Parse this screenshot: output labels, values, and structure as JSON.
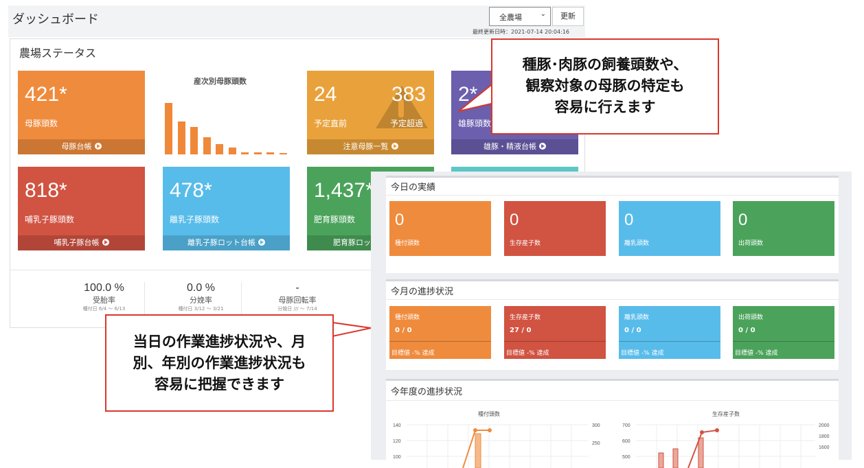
{
  "header": {
    "title": "ダッシュボード",
    "farm_select": "全農場",
    "refresh_label": "更新",
    "last_updated": "最終更新日時：2021-07-14 20:04:16"
  },
  "status": {
    "title": "農場ステータス",
    "sow": {
      "value": "421*",
      "label": "母豚頭数",
      "link": "母豚台帳"
    },
    "parity_chart": {
      "title": "産次別母豚頭数",
      "values": [
        72,
        46,
        38,
        24,
        14,
        10,
        3,
        3,
        3,
        1
      ]
    },
    "due": {
      "value_left": "24",
      "label_left": "予定直前",
      "value_right": "383",
      "label_right": "予定超過",
      "link": "注意母豚一覧"
    },
    "boar": {
      "value": "2*",
      "label": "雄豚頭数",
      "link": "雄豚・精液台帳"
    },
    "suckling": {
      "value": "818*",
      "label": "哺乳子豚頭数",
      "link": "哺乳子豚台帳"
    },
    "weaned": {
      "value": "478*",
      "label": "離乳子豚頭数",
      "link": "離乳子豚ロット台帳"
    },
    "fattening": {
      "value": "1,437*",
      "label": "肥育豚頭数",
      "link": "肥育豚ロッ"
    },
    "stats": [
      {
        "value": "100.0 %",
        "label": "受胎率",
        "sub": "種付日 6/4 ～ 6/13"
      },
      {
        "value": "0.0 %",
        "label": "分娩率",
        "sub": "種付日 3/12 ～ 3/21"
      },
      {
        "value": "-",
        "label": "母豚回転率",
        "sub": "分娩日 /// ～ 7/14"
      }
    ]
  },
  "today": {
    "title": "今日の実績",
    "tiles": [
      {
        "value": "0",
        "label": "種付頭数",
        "color": "#ef8b3d"
      },
      {
        "value": "0",
        "label": "生存産子数",
        "color": "#d15342"
      },
      {
        "value": "0",
        "label": "離乳頭数",
        "color": "#58bcea"
      },
      {
        "value": "0",
        "label": "出荷頭数",
        "color": "#4ba35b"
      }
    ]
  },
  "month": {
    "title": "今月の進捗状況",
    "tiles": [
      {
        "label": "種付頭数",
        "value": "0 / 0",
        "target": "目標値 -% 達成",
        "color": "#ef8b3d"
      },
      {
        "label": "生存産子数",
        "value": "27 / 0",
        "target": "目標値 -% 達成",
        "color": "#d15342"
      },
      {
        "label": "離乳頭数",
        "value": "0 / 0",
        "target": "目標値 -% 達成",
        "color": "#58bcea"
      },
      {
        "label": "出荷頭数",
        "value": "0 / 0",
        "target": "目標値 -% 達成",
        "color": "#4ba35b"
      }
    ]
  },
  "year": {
    "title": "今年度の進捗状況",
    "charts": [
      {
        "title": "種付頭数",
        "left_ticks": [
          "140",
          "120",
          "100"
        ],
        "right_ticks": [
          "300",
          "250"
        ]
      },
      {
        "title": "生存産子数",
        "left_ticks": [
          "700",
          "600",
          "500"
        ],
        "right_ticks": [
          "2000",
          "1800",
          "1600"
        ]
      }
    ]
  },
  "callouts": {
    "top": [
      "種豚･肉豚の飼養頭数や、",
      "観察対象の母豚の特定も",
      "容易に行えます"
    ],
    "bottom": [
      "当日の作業進捗状況や、月",
      "別、年別の作業進捗状況も",
      "容易に把握できます"
    ]
  }
}
